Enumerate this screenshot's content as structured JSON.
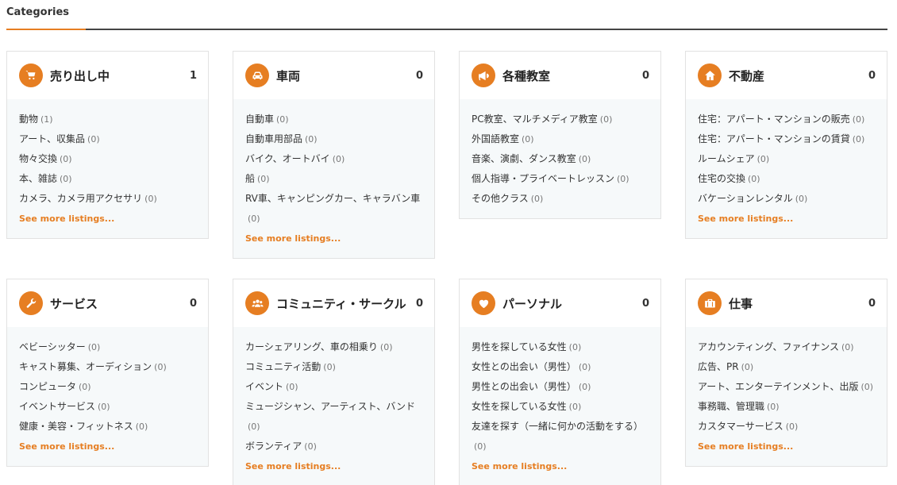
{
  "page": {
    "title": "Categories"
  },
  "colors": {
    "accent": "#e67e22"
  },
  "cards": [
    {
      "name": "uri",
      "icon": "cart-icon",
      "title": "売り出し中",
      "count": "1",
      "items": [
        {
          "label": "動物",
          "count": "(1)"
        },
        {
          "label": "アート、収集品",
          "count": "(0)"
        },
        {
          "label": "物々交換",
          "count": "(0)"
        },
        {
          "label": "本、雑誌",
          "count": "(0)"
        },
        {
          "label": "カメラ、カメラ用アクセサリ",
          "count": "(0)"
        }
      ],
      "more": "See more listings..."
    },
    {
      "name": "vehicle",
      "icon": "car-icon",
      "title": "車両",
      "count": "0",
      "items": [
        {
          "label": "自動車",
          "count": "(0)"
        },
        {
          "label": "自動車用部品",
          "count": "(0)"
        },
        {
          "label": "バイク、オートバイ",
          "count": "(0)"
        },
        {
          "label": "船",
          "count": "(0)"
        },
        {
          "label": "RV車、キャンピングカー、キャラバン車",
          "count": "(0)"
        }
      ],
      "more": "See more listings..."
    },
    {
      "name": "classes",
      "icon": "megaphone-icon",
      "title": "各種教室",
      "count": "0",
      "items": [
        {
          "label": "PC教室、マルチメディア教室",
          "count": "(0)"
        },
        {
          "label": "外国語教室",
          "count": "(0)"
        },
        {
          "label": "音楽、演劇、ダンス教室",
          "count": "(0)"
        },
        {
          "label": "個人指導・プライベートレッスン",
          "count": "(0)"
        },
        {
          "label": "その他クラス",
          "count": "(0)"
        }
      ],
      "more": ""
    },
    {
      "name": "realestate",
      "icon": "home-icon",
      "title": "不動産",
      "count": "0",
      "items": [
        {
          "label": "住宅：アパート・マンションの販売",
          "count": "(0)"
        },
        {
          "label": "住宅：アパート・マンションの賃貸",
          "count": "(0)"
        },
        {
          "label": "ルームシェア",
          "count": "(0)"
        },
        {
          "label": "住宅の交換",
          "count": "(0)"
        },
        {
          "label": "バケーションレンタル",
          "count": "(0)"
        }
      ],
      "more": "See more listings..."
    },
    {
      "name": "service",
      "icon": "wrench-icon",
      "title": "サービス",
      "count": "0",
      "items": [
        {
          "label": "ベビーシッター",
          "count": "(0)"
        },
        {
          "label": "キャスト募集、オーディション",
          "count": "(0)"
        },
        {
          "label": "コンピュータ",
          "count": "(0)"
        },
        {
          "label": "イベントサービス",
          "count": "(0)"
        },
        {
          "label": "健康・美容・フィットネス",
          "count": "(0)"
        }
      ],
      "more": "See more listings..."
    },
    {
      "name": "community",
      "icon": "users-icon",
      "title": "コミュニティ・サークル",
      "count": "0",
      "items": [
        {
          "label": "カーシェアリング、車の相乗り",
          "count": "(0)"
        },
        {
          "label": "コミュニティ活動",
          "count": "(0)"
        },
        {
          "label": "イベント",
          "count": "(0)"
        },
        {
          "label": "ミュージシャン、アーティスト、バンド",
          "count": "(0)"
        },
        {
          "label": "ボランティア",
          "count": "(0)"
        }
      ],
      "more": "See more listings..."
    },
    {
      "name": "personal",
      "icon": "heart-icon",
      "title": "パーソナル",
      "count": "0",
      "items": [
        {
          "label": "男性を探している女性",
          "count": "(0)"
        },
        {
          "label": "女性との出会い（男性）",
          "count": "(0)"
        },
        {
          "label": "男性との出会い（男性）",
          "count": "(0)"
        },
        {
          "label": "女性を探している女性",
          "count": "(0)"
        },
        {
          "label": "友達を探す（一緒に何かの活動をする）",
          "count": "(0)"
        }
      ],
      "more": "See more listings..."
    },
    {
      "name": "jobs",
      "icon": "briefcase-icon",
      "title": "仕事",
      "count": "0",
      "items": [
        {
          "label": "アカウンティング、ファイナンス",
          "count": "(0)"
        },
        {
          "label": "広告、PR",
          "count": "(0)"
        },
        {
          "label": "アート、エンターテインメント、出版",
          "count": "(0)"
        },
        {
          "label": "事務職、管理職",
          "count": "(0)"
        },
        {
          "label": "カスタマーサービス",
          "count": "(0)"
        }
      ],
      "more": "See more listings..."
    }
  ]
}
